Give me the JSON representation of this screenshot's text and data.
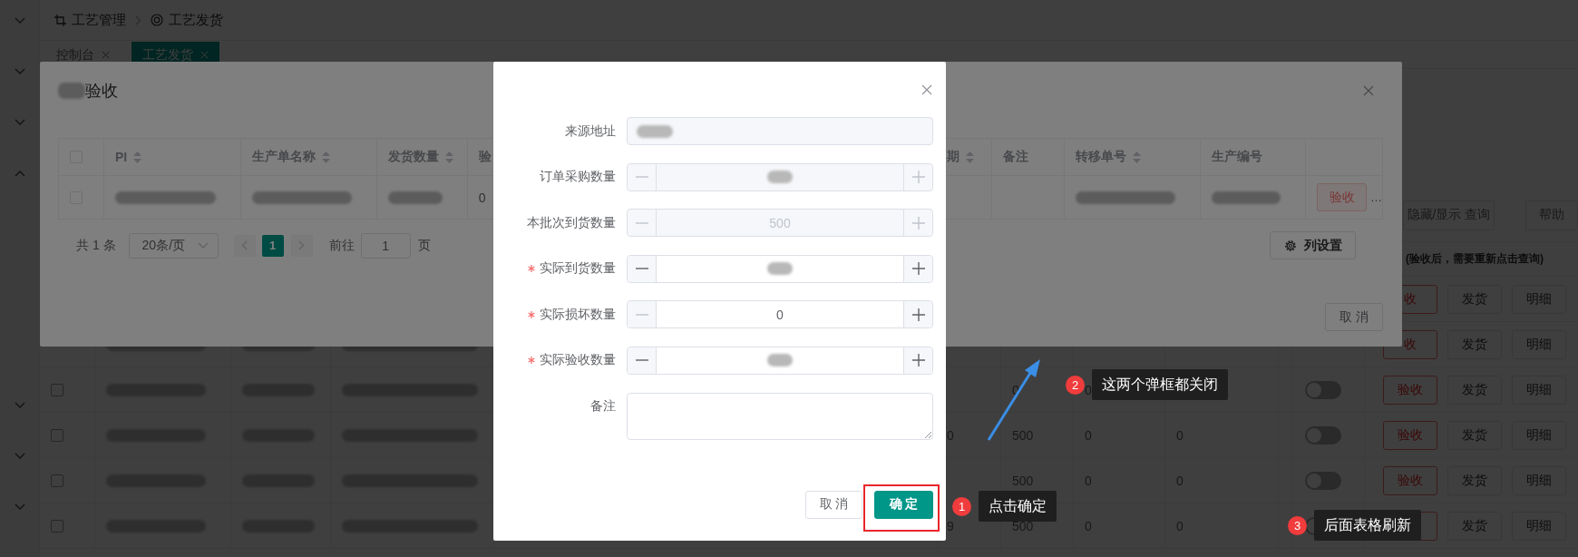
{
  "sidebar": {
    "items": [
      {
        "expanded": false
      },
      {
        "expanded": false
      },
      {
        "expanded": false
      },
      {
        "expanded": true
      },
      {
        "expanded": false
      },
      {
        "expanded": false
      },
      {
        "expanded": false
      }
    ]
  },
  "breadcrumb": [
    {
      "label": "工艺管理"
    },
    {
      "label": "工艺发货"
    }
  ],
  "tabs": [
    {
      "label": "控制台",
      "selected": false
    },
    {
      "label": "工艺发货",
      "selected": true
    }
  ],
  "toolbar": {
    "buttons": [
      "隐藏/显示 查询",
      "帮助"
    ],
    "note": "(验收后，需要重新点击查询)"
  },
  "table": {
    "rows": [
      {
        "actions": [
          {
            "label": "收",
            "kind": "accept"
          },
          {
            "label": "发货",
            "kind": "plain"
          },
          {
            "label": "明细",
            "kind": "plain"
          }
        ]
      },
      {
        "redacted": true,
        "actions": [
          {
            "label": "收",
            "kind": "accept"
          },
          {
            "label": "发货",
            "kind": "plain"
          },
          {
            "label": "明细",
            "kind": "plain"
          }
        ]
      },
      {
        "redacted": true,
        "checked": false,
        "on": false,
        "column_2": "0",
        "column_3": "0",
        "actions": [
          {
            "label": "验收",
            "kind": "accept"
          },
          {
            "label": "发货",
            "kind": "plain"
          },
          {
            "label": "明细",
            "kind": "plain"
          }
        ]
      },
      {
        "redacted": true,
        "checked": false,
        "on": false,
        "column_1": "0",
        "column_2": "500",
        "column_3": "0",
        "column_4": "0",
        "actions": [
          {
            "label": "验收",
            "kind": "accept"
          },
          {
            "label": "发货",
            "kind": "plain"
          },
          {
            "label": "明细",
            "kind": "plain"
          }
        ]
      },
      {
        "redacted": true,
        "checked": false,
        "on": false,
        "column_2": "500",
        "column_3": "0",
        "column_4": "0",
        "actions": [
          {
            "label": "验收",
            "kind": "accept"
          },
          {
            "label": "发货",
            "kind": "plain"
          },
          {
            "label": "明细",
            "kind": "plain"
          }
        ]
      },
      {
        "redacted": true,
        "checked": false,
        "on": false,
        "column_1": "9",
        "column_2": "500",
        "column_3": "0",
        "column_4": "0",
        "actions": [
          {
            "kind": "accept"
          },
          {
            "label": "发货",
            "kind": "plain"
          },
          {
            "label": "明细",
            "kind": "plain"
          }
        ]
      }
    ]
  },
  "accept_dialog": {
    "title": "验收",
    "columns": [
      {
        "label": "PI",
        "sortable": true
      },
      {
        "label": "生产单名称",
        "sortable": true
      },
      {
        "label": "发货数量",
        "sortable": true
      },
      {
        "label": "验",
        "sortable": false
      },
      {
        "label": "期",
        "sortable": true
      },
      {
        "label": "备注",
        "sortable": false
      },
      {
        "label": "转移单号",
        "sortable": true
      },
      {
        "label": "生产编号",
        "sortable": false
      }
    ],
    "select_all": {
      "checked": false
    },
    "rows": [
      {
        "checked": false,
        "cells": [
          {
            "redacted": true
          },
          {
            "redacted": true
          },
          {
            "redacted": true
          },
          {
            "text": "0"
          },
          {},
          {},
          {
            "redacted": true
          },
          {
            "redacted": true
          }
        ],
        "action": "验收",
        "more": "…"
      }
    ],
    "pagination": {
      "total": "共 1 条",
      "page_size": "20条/页",
      "pages": [
        {
          "label": "1",
          "selected": true
        }
      ],
      "goto_label": "前往",
      "goto_value": "1",
      "page_unit": "页"
    },
    "column_settings": "列设置",
    "cancel": "取 消"
  },
  "form_dialog": {
    "fields": [
      {
        "kind": "text",
        "label": "来源地址",
        "required": false,
        "disabled": true,
        "redacted": true
      },
      {
        "kind": "number",
        "label": "订单采购数量",
        "required": false,
        "disabled": true,
        "redacted": true,
        "minus_disabled": true
      },
      {
        "kind": "number",
        "label": "本批次到货数量",
        "required": false,
        "disabled": true,
        "value": "500",
        "minus_disabled": true
      },
      {
        "kind": "number",
        "label": "实际到货数量",
        "required": true,
        "disabled": false,
        "redacted": true,
        "minus_disabled": false
      },
      {
        "kind": "number",
        "label": "实际损坏数量",
        "required": true,
        "disabled": false,
        "value": "0",
        "minus_disabled": true
      },
      {
        "kind": "number",
        "label": "实际验收数量",
        "required": true,
        "disabled": false,
        "redacted": true,
        "minus_disabled": false
      },
      {
        "kind": "textarea",
        "label": "备注",
        "required": false
      }
    ],
    "buttons": [
      {
        "label": "取 消",
        "kind": "default"
      },
      {
        "label": "确 定",
        "kind": "primary"
      }
    ]
  },
  "annotations": [
    {
      "number": "1",
      "text": "点击确定"
    },
    {
      "number": "2",
      "text": "这两个弹框都关闭"
    },
    {
      "number": "3",
      "text": "后面表格刷新"
    }
  ]
}
